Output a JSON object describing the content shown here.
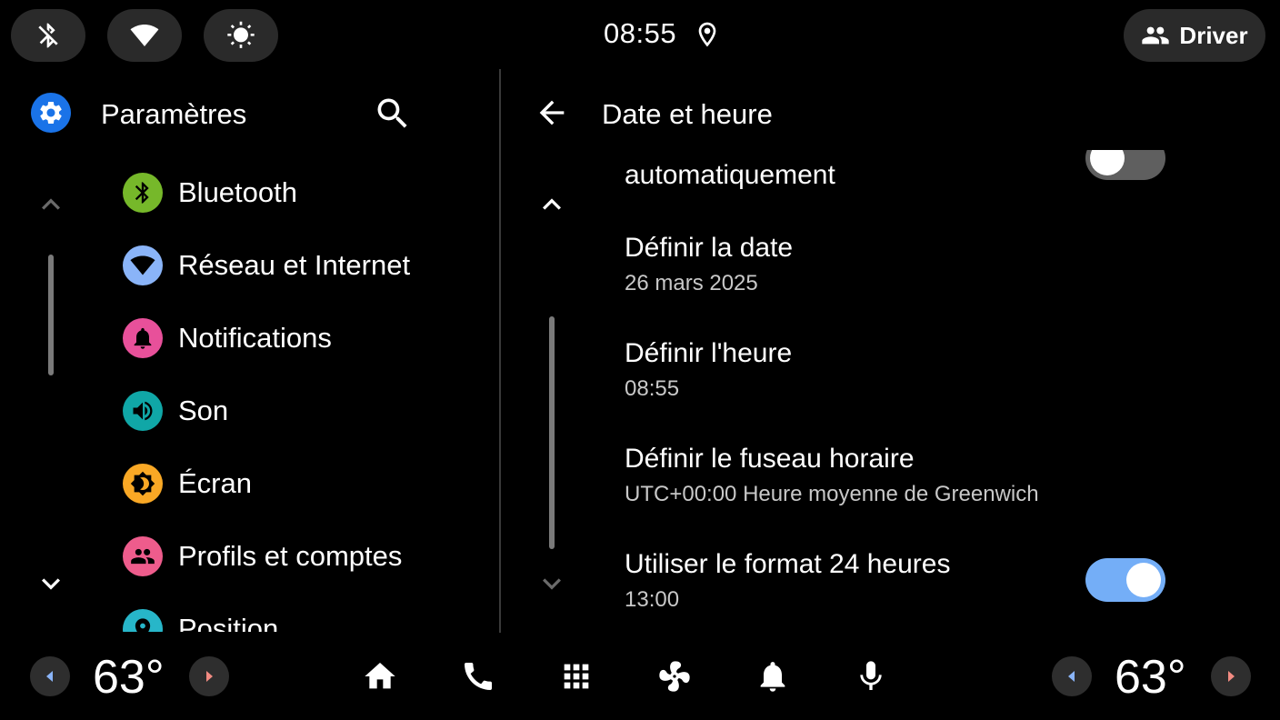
{
  "status_bar": {
    "quick_buttons": [
      {
        "name": "bluetooth-off-icon"
      },
      {
        "name": "wifi-icon"
      },
      {
        "name": "brightness-icon"
      }
    ],
    "time": "08:55",
    "location_icon": "location-pin-icon",
    "profile": {
      "icon": "people-icon",
      "label": "Driver"
    }
  },
  "sidebar": {
    "title": "Paramètres",
    "header_icon": "gear-icon",
    "search_icon": "search-icon",
    "items": [
      {
        "label": "Bluetooth",
        "icon": "bluetooth-icon",
        "color": "#76b82a"
      },
      {
        "label": "Réseau et Internet",
        "icon": "wifi-icon",
        "color": "#8ab4f8"
      },
      {
        "label": "Notifications",
        "icon": "bell-icon",
        "color": "#e8509a"
      },
      {
        "label": "Son",
        "icon": "volume-icon",
        "color": "#10a7a7"
      },
      {
        "label": "Écran",
        "icon": "brightness-icon",
        "color": "#f9a825"
      },
      {
        "label": "Profils et comptes",
        "icon": "people-icon",
        "color": "#ee5c8c"
      },
      {
        "label": "Position",
        "icon": "location-icon",
        "color": "#27b6c9"
      }
    ]
  },
  "detail": {
    "title": "Date et heure",
    "rows": [
      {
        "title": "automatiquement",
        "subtitle": "",
        "toggle": "off"
      },
      {
        "title": "Définir la date",
        "subtitle": "26 mars 2025"
      },
      {
        "title": "Définir l'heure",
        "subtitle": "08:55"
      },
      {
        "title": "Définir le fuseau horaire",
        "subtitle": "UTC+00:00 Heure moyenne de Greenwich"
      },
      {
        "title": "Utiliser le format 24 heures",
        "subtitle": "13:00",
        "toggle": "on"
      }
    ]
  },
  "bottom_bar": {
    "left_temp": "63°",
    "right_temp": "63°",
    "dock_icons": [
      "home-icon",
      "phone-icon",
      "apps-grid-icon",
      "fan-icon",
      "bell-icon",
      "microphone-icon"
    ]
  },
  "colors": {
    "accent_blue": "#1a73e8",
    "toggle_on": "#74aef7",
    "toggle_off": "#5f5f5f",
    "arrow_left": "#8ab4f8",
    "arrow_right": "#f28b82"
  }
}
